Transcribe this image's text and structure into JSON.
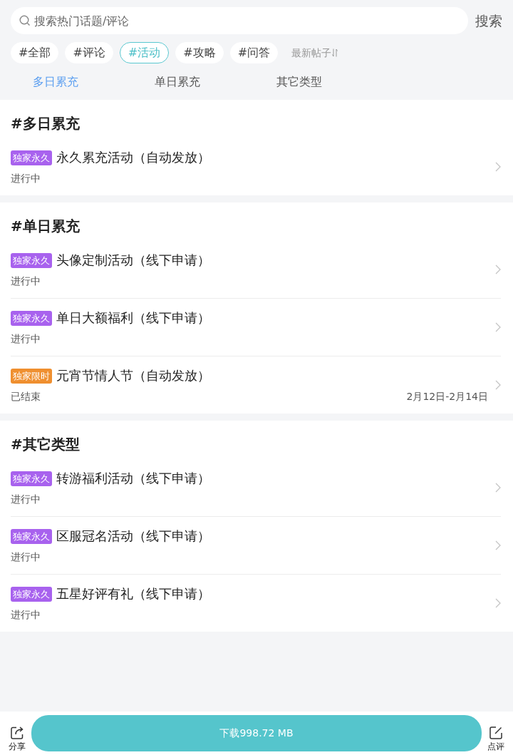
{
  "search": {
    "placeholder": "搜索热门话题/评论",
    "button": "搜索"
  },
  "filter_chips": [
    {
      "label": "#全部",
      "selected": false
    },
    {
      "label": "#评论",
      "selected": false
    },
    {
      "label": "#活动",
      "selected": true
    },
    {
      "label": "#攻略",
      "selected": false
    },
    {
      "label": "#问答",
      "selected": false
    }
  ],
  "sort": {
    "label": "最新帖子"
  },
  "tabs": [
    {
      "label": "多日累充",
      "selected": true
    },
    {
      "label": "单日累充",
      "selected": false
    },
    {
      "label": "其它类型",
      "selected": false
    }
  ],
  "sections": [
    {
      "title": "#多日累充",
      "items": [
        {
          "badge": {
            "text": "独家永久",
            "color": "#a862ee"
          },
          "title": "永久累充活动（自动发放）",
          "status": "进行中"
        }
      ]
    },
    {
      "title": "#单日累充",
      "items": [
        {
          "badge": {
            "text": "独家永久",
            "color": "#a862ee"
          },
          "title": "头像定制活动（线下申请）",
          "status": "进行中"
        },
        {
          "badge": {
            "text": "独家永久",
            "color": "#a862ee"
          },
          "title": "单日大额福利（线下申请）",
          "status": "进行中"
        },
        {
          "badge": {
            "text": "独家限时",
            "color": "#ef8f2f"
          },
          "title": "元宵节情人节（自动发放）",
          "status": "已结束",
          "date": "2月12日-2月14日"
        }
      ]
    },
    {
      "title": "#其它类型",
      "items": [
        {
          "badge": {
            "text": "独家永久",
            "color": "#a862ee"
          },
          "title": "转游福利活动（线下申请）",
          "status": "进行中"
        },
        {
          "badge": {
            "text": "独家永久",
            "color": "#a862ee"
          },
          "title": "区服冠名活动（线下申请）",
          "status": "进行中"
        },
        {
          "badge": {
            "text": "独家永久",
            "color": "#a862ee"
          },
          "title": "五星好评有礼（线下申请）",
          "status": "进行中"
        }
      ]
    }
  ],
  "bottom_bar": {
    "share": "分享",
    "download": "下载998.72 MB",
    "review": "点评"
  }
}
